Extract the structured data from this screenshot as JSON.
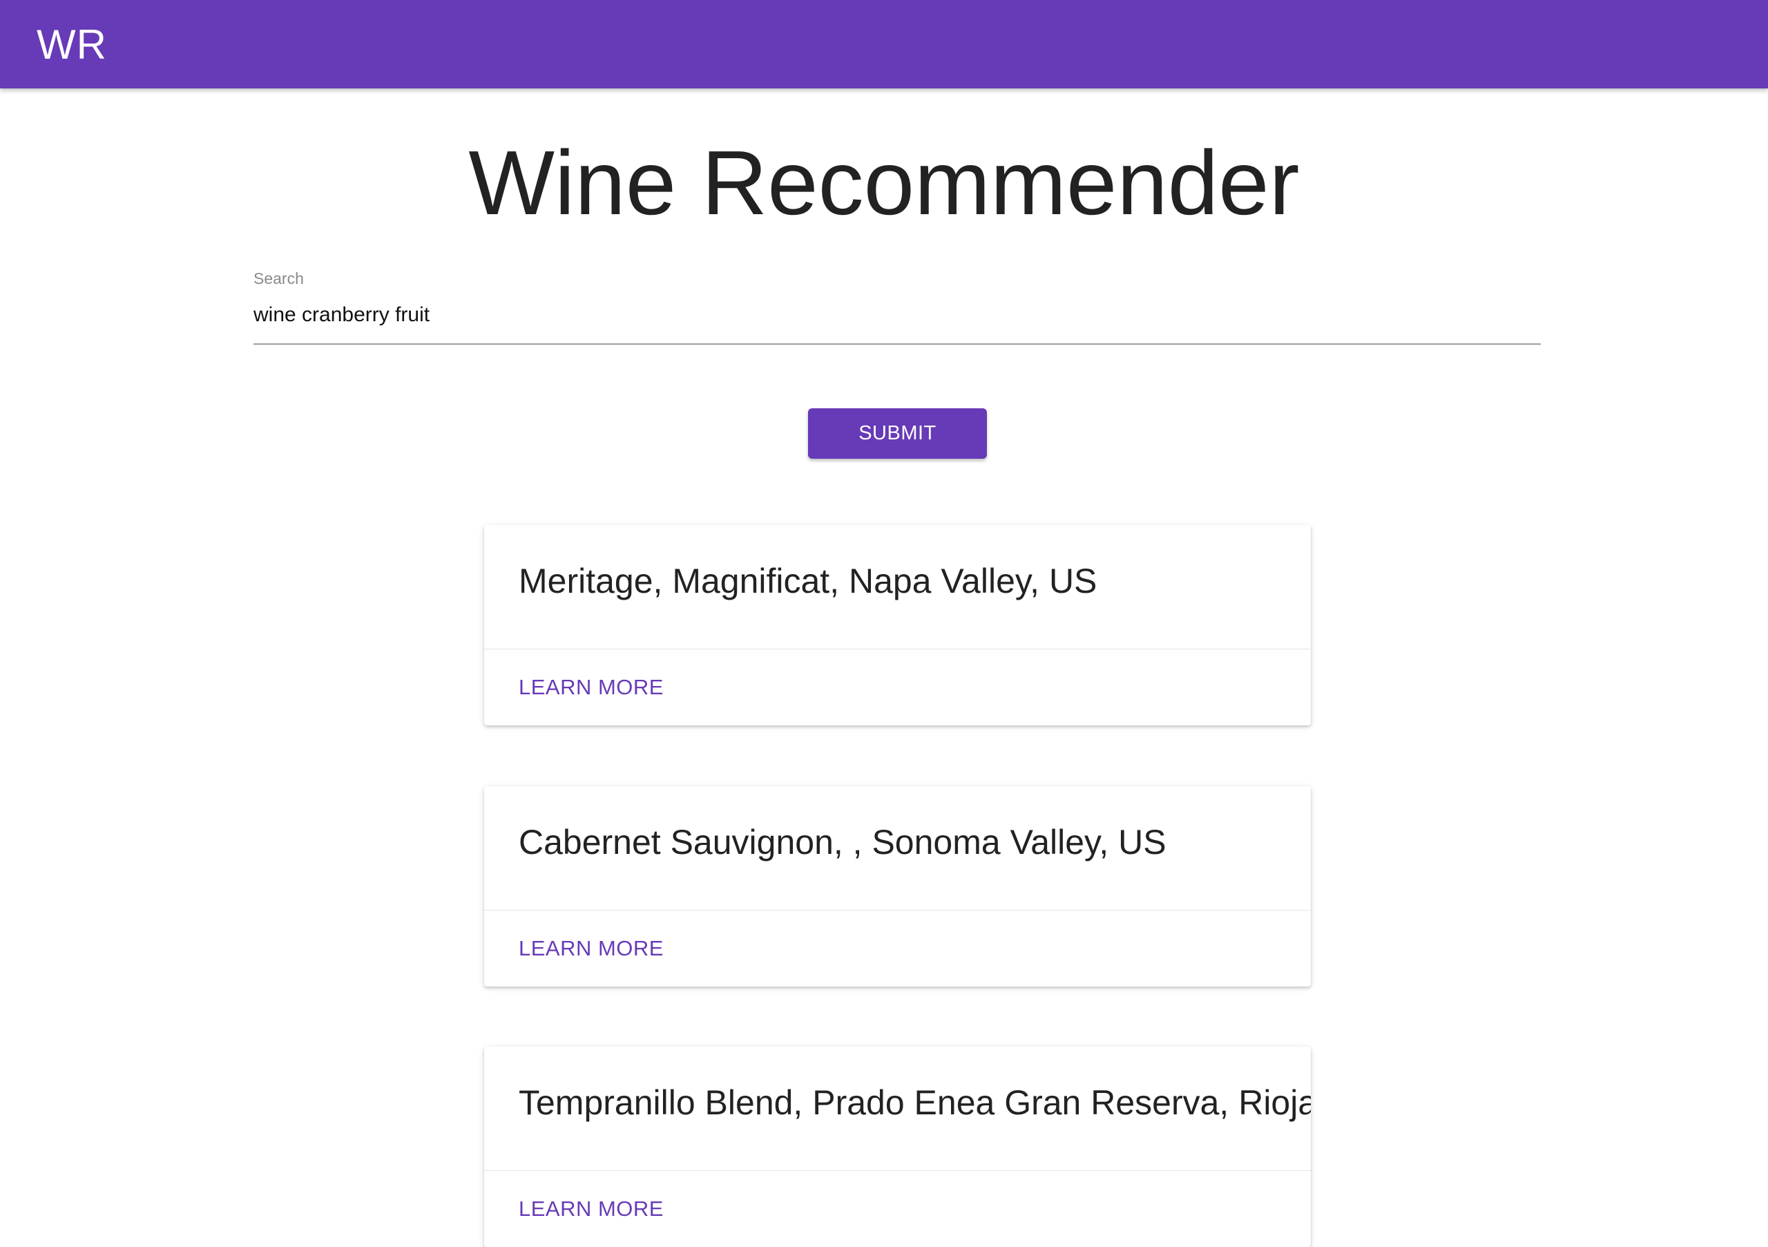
{
  "appbar": {
    "brand": "WR",
    "color": "#673ab7"
  },
  "page": {
    "title": "Wine Recommender"
  },
  "search": {
    "label": "Search",
    "value": "wine cranberry fruit",
    "placeholder": ""
  },
  "submit": {
    "label": "SUBMIT"
  },
  "results": [
    {
      "title": "Meritage, Magnificat, Napa Valley, US",
      "action": "LEARN MORE"
    },
    {
      "title": "Cabernet Sauvignon, , Sonoma Valley, US",
      "action": "LEARN MORE"
    },
    {
      "title": "Tempranillo Blend, Prado Enea Gran Reserva, Rioja,",
      "action": "LEARN MORE"
    }
  ]
}
